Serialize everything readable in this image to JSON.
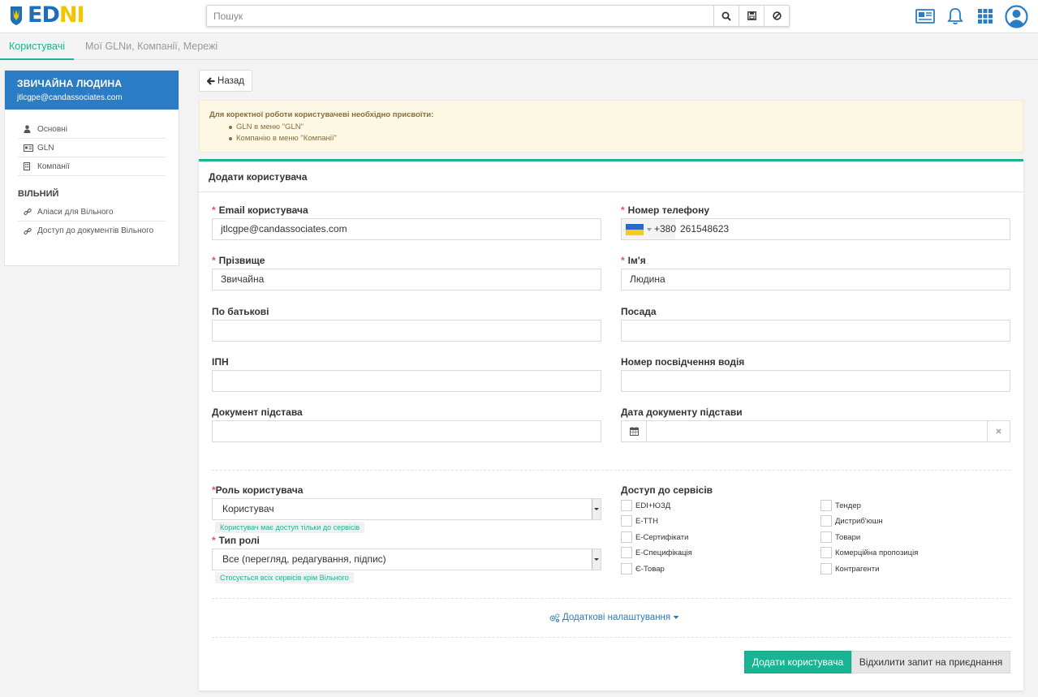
{
  "header": {
    "logo": {
      "text_a": "ED",
      "text_b": "N",
      "text_c": "I"
    },
    "search": {
      "placeholder": "Пошук"
    },
    "icons": [
      "search-icon",
      "save-icon",
      "ban-icon",
      "news-icon",
      "bell-icon",
      "apps-grid-icon",
      "user-avatar-icon"
    ]
  },
  "tabs": [
    {
      "label": "Користувачі",
      "active": true
    },
    {
      "label": "Мої GLNи, Компанії, Мережі",
      "active": false
    }
  ],
  "sidebar": {
    "user_name": "ЗВИЧАЙНА ЛЮДИНА",
    "user_email": "jtlcgpe@candassociates.com",
    "items": [
      {
        "label": "Основні",
        "icon": "user-icon"
      },
      {
        "label": "GLN",
        "icon": "id-card-icon"
      },
      {
        "label": "Компанії",
        "icon": "building-icon"
      }
    ],
    "group_title": "ВІЛЬНИЙ",
    "group_items": [
      {
        "label": "Аліаси для Вільного",
        "icon": "link-icon"
      },
      {
        "label": "Доступ до документів Вільного",
        "icon": "link-icon"
      }
    ]
  },
  "back_button": {
    "label": "Назад"
  },
  "warning": {
    "title": "Для коректної роботи користувачеві необхідно присвоїти:",
    "items": [
      "GLN в меню \"GLN\"",
      "Компанію в меню \"Компанії\""
    ]
  },
  "form": {
    "title": "Додати користувача",
    "email": {
      "label": "Email користувача",
      "value": "jtlcgpe@candassociates.com",
      "required": true
    },
    "phone": {
      "label": "Номер телефону",
      "prefix": "+380",
      "value": "261548623",
      "required": true
    },
    "last_name": {
      "label": "Прізвище",
      "value": "Звичайна",
      "required": true
    },
    "first_name": {
      "label": "Ім'я",
      "value": "Людина",
      "required": true
    },
    "patronymic": {
      "label": "По батькові",
      "value": ""
    },
    "position": {
      "label": "Посада",
      "value": ""
    },
    "tax_id": {
      "label": "ІПН",
      "value": ""
    },
    "driver_license": {
      "label": "Номер посвідчення водія",
      "value": ""
    },
    "basis_doc": {
      "label": "Документ підстава",
      "value": ""
    },
    "basis_date": {
      "label": "Дата документу підстави",
      "value": ""
    },
    "role": {
      "label": "Роль користувача",
      "value": "Користувач",
      "hint": "Користувач має доступ тільки до сервісів"
    },
    "role_type": {
      "label": "Тип ролі",
      "value": "Все (перегляд, редагування, підпис)",
      "hint": "Стосується всіх сервісів крім Вільного"
    },
    "services": {
      "label": "Доступ до сервісів",
      "left": [
        "EDI+ЮЗД",
        "Е-ТТН",
        "Е-Сертифікати",
        "Е-Специфікація",
        "Є-Товар"
      ],
      "right": [
        "Тендер",
        "Дистриб'юшн",
        "Товари",
        "Комерційна пропозиція",
        "Контрагенти"
      ]
    },
    "extra_settings": "Додаткові налаштування",
    "submit": "Додати користувача",
    "reject": "Відхилити запит на приєднання"
  },
  "colors": {
    "accent": "#1ab394",
    "sidebar_header": "#2a7cc4",
    "required": "#e15555",
    "link": "#337ab7"
  }
}
